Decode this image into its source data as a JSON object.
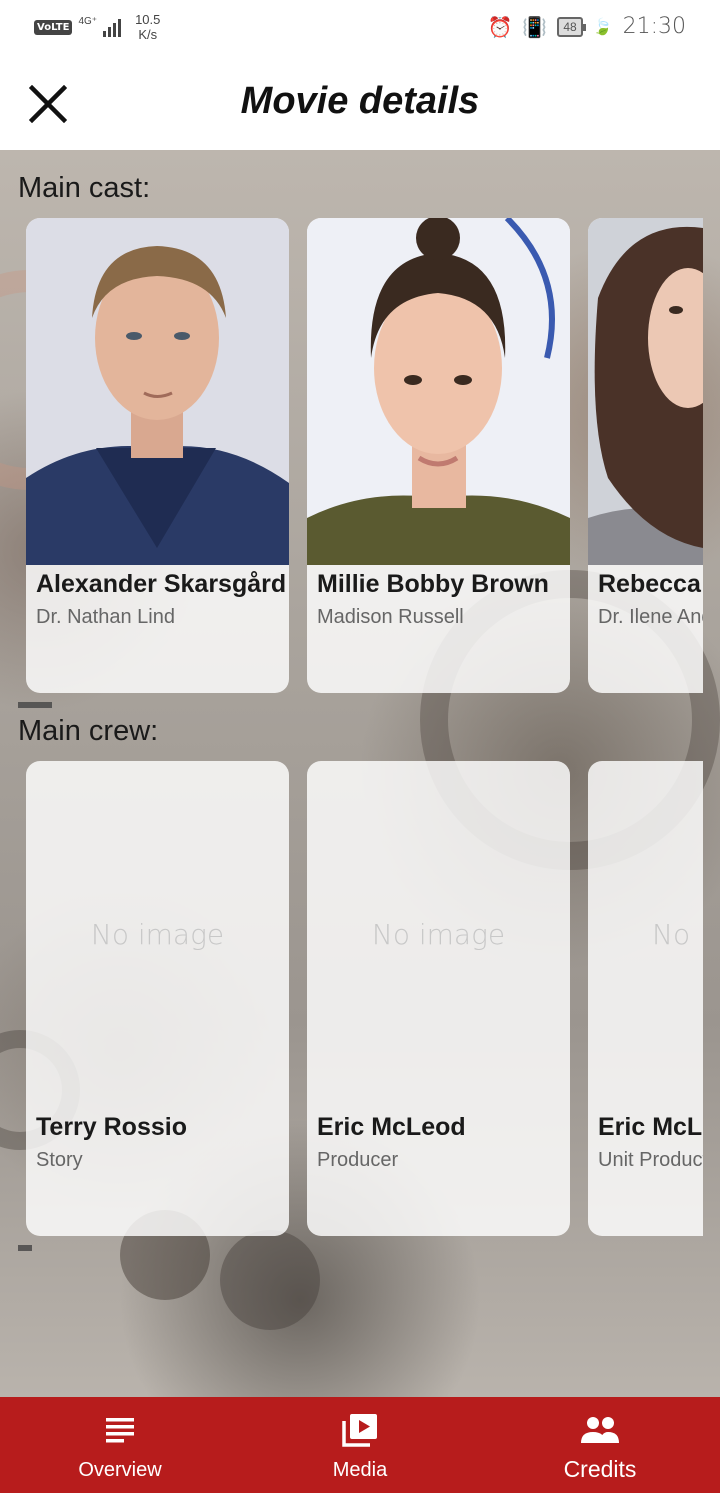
{
  "status_bar": {
    "network_badge": "VoLTE",
    "network_type": "4G⁺",
    "speed_value": "10.5",
    "speed_unit": "K/s",
    "battery": "48",
    "time": "21:30"
  },
  "header": {
    "title": "Movie details",
    "close_icon": "close-icon"
  },
  "cast": {
    "label": "Main cast:",
    "members": [
      {
        "name": "Alexander Skarsgård",
        "role": "Dr. Nathan Lind"
      },
      {
        "name": "Millie Bobby Brown",
        "role": "Madison Russell"
      },
      {
        "name": "Rebecca",
        "role": "Dr. Ilene And"
      }
    ]
  },
  "crew": {
    "label": "Main crew:",
    "no_image_text": "No image",
    "no_image_partial": "No",
    "members": [
      {
        "name": "Terry Rossio",
        "role": "Story"
      },
      {
        "name": "Eric McLeod",
        "role": "Producer"
      },
      {
        "name": "Eric McL",
        "role": "Unit Product"
      }
    ]
  },
  "bottom_nav": {
    "items": [
      {
        "label": "Overview",
        "icon": "list-icon"
      },
      {
        "label": "Media",
        "icon": "play-library-icon"
      },
      {
        "label": "Credits",
        "icon": "people-icon"
      }
    ],
    "active": "Credits"
  },
  "colors": {
    "accent": "#b71c1c",
    "title_text": "#111111"
  }
}
